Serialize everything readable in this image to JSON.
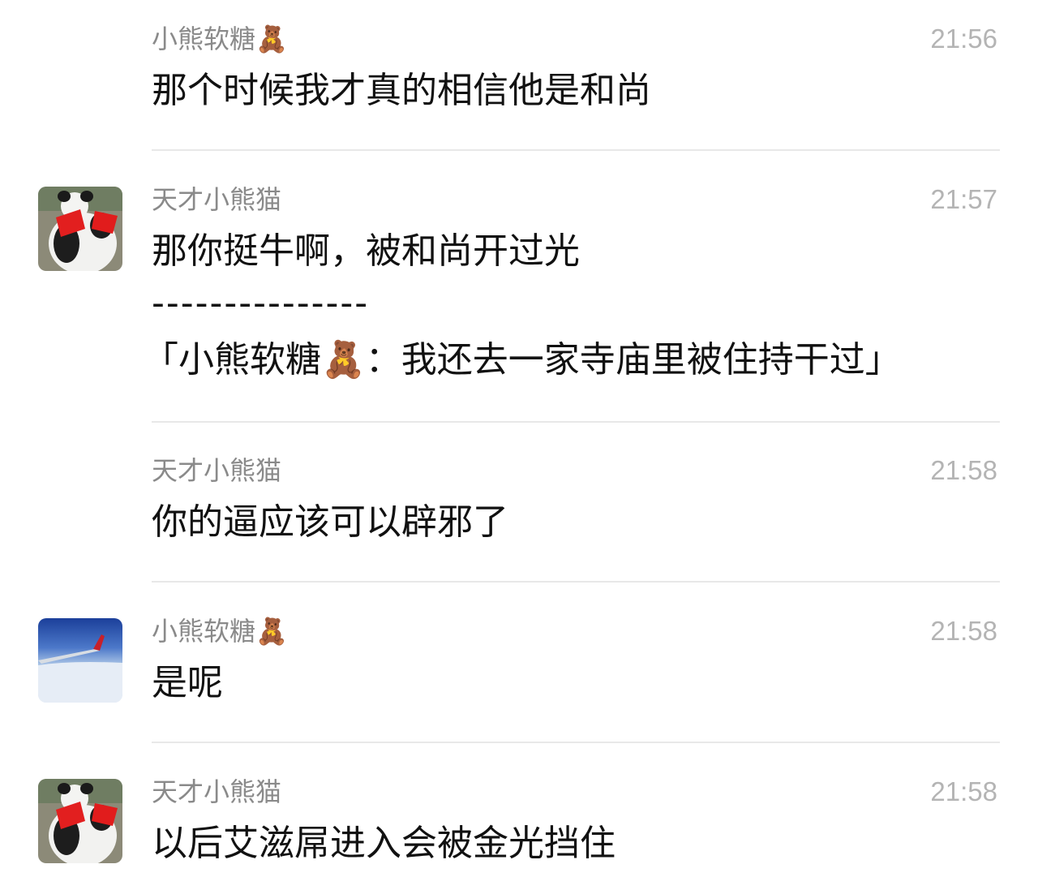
{
  "messages": [
    {
      "sender": "小熊软糖🧸",
      "time": "21:56",
      "lines": [
        "那个时候我才真的相信他是和尚"
      ],
      "avatar": "none"
    },
    {
      "sender": "天才小熊猫",
      "time": "21:57",
      "lines": [
        "那你挺牛啊，被和尚开过光",
        "---------------",
        "「小熊软糖🧸：我还去一家寺庙里被住持干过」"
      ],
      "avatar": "panda"
    },
    {
      "sender": "天才小熊猫",
      "time": "21:58",
      "lines": [
        "你的逼应该可以辟邪了"
      ],
      "avatar": "none"
    },
    {
      "sender": "小熊软糖🧸",
      "time": "21:58",
      "lines": [
        "是呢"
      ],
      "avatar": "airplane-sky"
    },
    {
      "sender": "天才小熊猫",
      "time": "21:58",
      "lines": [
        "以后艾滋屌进入会被金光挡住"
      ],
      "avatar": "panda"
    }
  ],
  "colors": {
    "name": "#8a8a8a",
    "time": "#b4b4b4",
    "text": "#111111",
    "divider": "#e8e8e8",
    "background": "#ffffff"
  }
}
